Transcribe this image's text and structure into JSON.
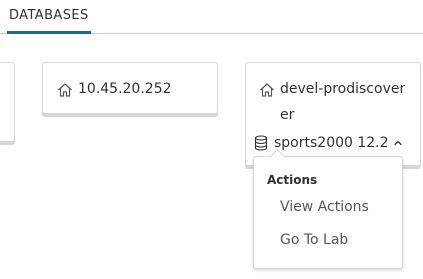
{
  "tabs": [
    {
      "label": "DATABASES",
      "active": true
    }
  ],
  "cards": {
    "mid": {
      "host": "10.45.20.252",
      "icon": "home-icon"
    },
    "right": {
      "host": "devel-prodiscoverer",
      "icon": "home-icon",
      "database": {
        "label": "sports2000 12.2",
        "icon": "database-icon",
        "expanded": true
      }
    }
  },
  "dropdown": {
    "header": "Actions",
    "items": [
      {
        "label": "View Actions"
      },
      {
        "label": "Go To Lab"
      }
    ]
  },
  "colors": {
    "accent": "#0072a3",
    "text": "#313131",
    "border": "#d7d7d7"
  }
}
